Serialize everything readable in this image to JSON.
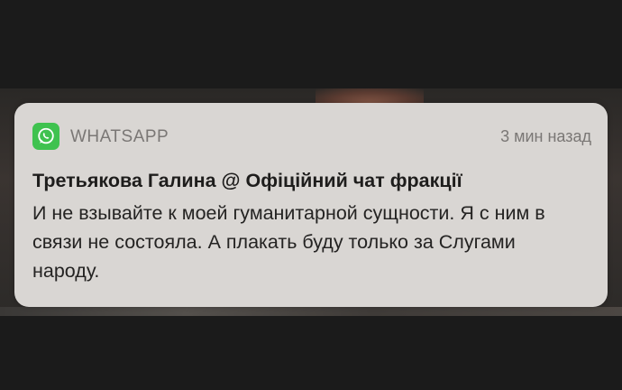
{
  "notification": {
    "app_name": "WHATSAPP",
    "app_icon": "whatsapp-icon",
    "app_color": "#3fc24f",
    "time": "3 мин назад",
    "title": "Третьякова Галина @ Офіційний чат фракції",
    "message": "И не взывайте к моей гуманитарной сущности. Я с ним в связи не состояла. А плакать буду только за Слугами народу."
  }
}
